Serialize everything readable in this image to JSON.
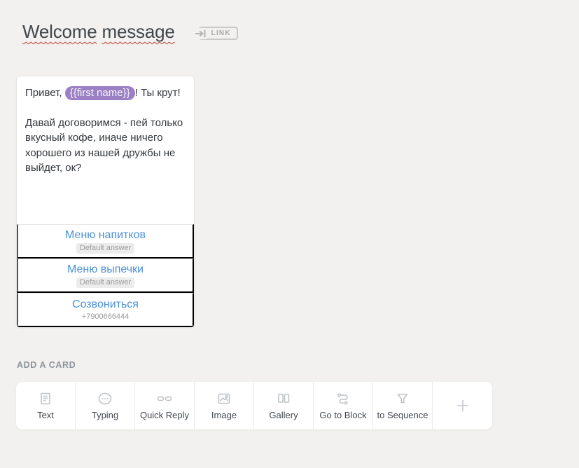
{
  "header": {
    "title": "Welcome message",
    "title_words": [
      "Welcome",
      "message"
    ],
    "link_button_label": "LINK",
    "link_button_icon": "link-arrow-icon"
  },
  "message_card": {
    "text_before_variable": "Привет, ",
    "variable_chip": "{{first name}}",
    "text_after_variable": "! Ты крут!",
    "paragraph2": "Давай договоримся - пей только вкусный кофе, иначе ничего хорошего из нашей дружбы не выйдет, ок?",
    "buttons": [
      {
        "label": "Меню напитков",
        "sublabel": "Default answer",
        "sublabel_style": "pill"
      },
      {
        "label": "Меню выпечки",
        "sublabel": "Default answer",
        "sublabel_style": "pill"
      },
      {
        "label": "Созвониться",
        "sublabel": "+7900666444",
        "sublabel_style": "plain"
      }
    ]
  },
  "add_card": {
    "label": "ADD A CARD",
    "items": [
      {
        "label": "Text",
        "icon": "text-icon"
      },
      {
        "label": "Typing",
        "icon": "typing-icon"
      },
      {
        "label": "Quick Reply",
        "icon": "quick-reply-icon"
      },
      {
        "label": "Image",
        "icon": "image-icon"
      },
      {
        "label": "Gallery",
        "icon": "gallery-icon"
      },
      {
        "label": "Go to Block",
        "icon": "go-to-block-icon"
      },
      {
        "label": "to Sequence",
        "icon": "to-sequence-icon"
      }
    ],
    "plus_button_icon": "plus-icon"
  },
  "colors": {
    "accent_blue": "#4a90d9",
    "variable_purple": "#9b80c4",
    "spellcheck_red": "#bf4136",
    "page_background": "#f2f1ef",
    "muted_gray": "#9b9b9b"
  }
}
